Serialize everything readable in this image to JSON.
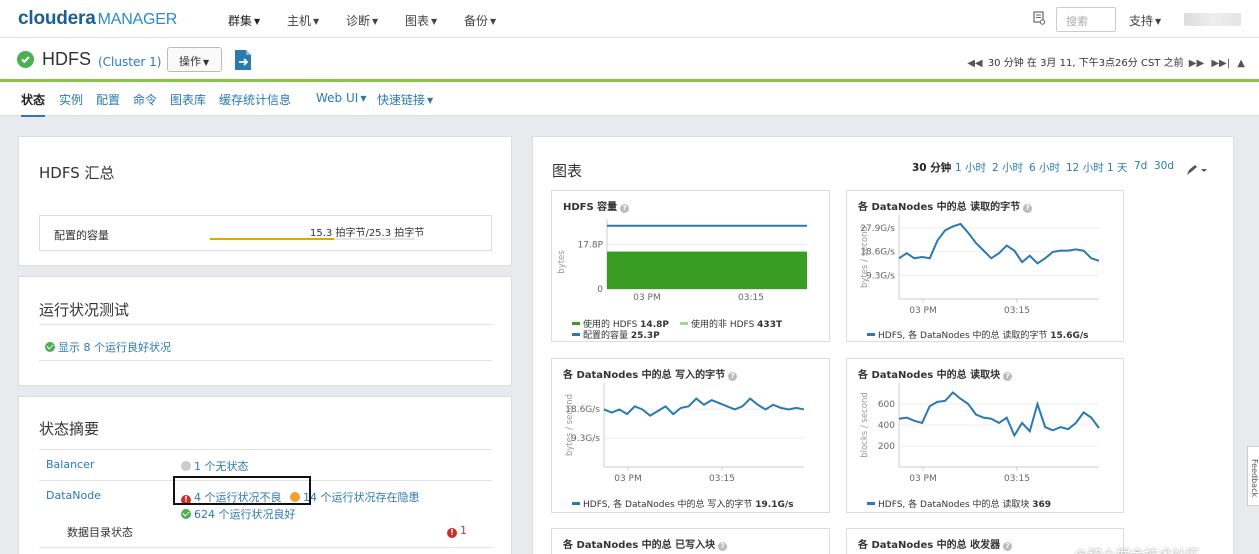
{
  "brand": {
    "name": "cloudera",
    "product": "MANAGER"
  },
  "topnav": {
    "items": [
      {
        "label": "群集",
        "active": true
      },
      {
        "label": "主机"
      },
      {
        "label": "诊断"
      },
      {
        "label": "图表"
      },
      {
        "label": "备份"
      }
    ],
    "search_placeholder": "搜索",
    "support_label": "支持"
  },
  "service": {
    "name": "HDFS",
    "cluster": "(Cluster 1)",
    "actions_label": "操作",
    "status": "good",
    "timeline": "30 分钟 在 3月 11, 下午3点26分 CST 之前"
  },
  "tabs": [
    {
      "label": "状态",
      "active": true
    },
    {
      "label": "实例"
    },
    {
      "label": "配置"
    },
    {
      "label": "命令"
    },
    {
      "label": "图表库"
    },
    {
      "label": "缓存统计信息"
    },
    {
      "label": "Web UI",
      "dropdown": true
    },
    {
      "label": "快速链接",
      "dropdown": true
    }
  ],
  "summary": {
    "title": "HDFS 汇总",
    "capacity_label": "配置的容量",
    "capacity_value": "15.3 拍字节/25.3 拍字节",
    "capacity_fraction": 0.605
  },
  "health_tests": {
    "title": "运行状况测试",
    "link": "显示 8 个运行良好状况"
  },
  "status_summary": {
    "title": "状态摘要",
    "balancer": {
      "label": "Balancer",
      "status": "1 个无状态"
    },
    "datanode": {
      "label": "DataNode",
      "bad": "4 个运行状况不良",
      "concerning": "14 个运行状况存在隐患",
      "good": "624 个运行状况良好"
    },
    "data_dir": {
      "label": "数据目录状态",
      "count": "1"
    }
  },
  "charts": {
    "title": "图表",
    "ranges": [
      "30 分钟",
      "1 小时",
      "2 小时",
      "6 小时",
      "12 小时",
      "1 天",
      "7d",
      "30d"
    ],
    "selected_range": "30 分钟",
    "x_ticks": [
      "03 PM",
      "03:15"
    ]
  },
  "chart_data": [
    {
      "type": "area",
      "title": "HDFS 容量",
      "ylabel": "bytes",
      "y_ticks": [
        "17.8P",
        "0"
      ],
      "series": [
        {
          "name": "使用的 HDFS",
          "value": "14.8P",
          "color": "#3a9d23"
        },
        {
          "name": "使用的非 HDFS",
          "value": "433T",
          "color": "#a6d49a"
        },
        {
          "name": "配置的容量",
          "value": "25.3P",
          "color": "#2a7ab0"
        }
      ]
    },
    {
      "type": "line",
      "title": "各 DataNodes 中的总 读取的字节",
      "ylabel": "bytes / second",
      "y_ticks": [
        "27.9G/s",
        "18.6G/s",
        "9.3G/s"
      ],
      "ylim": [
        0,
        33
      ],
      "values": [
        16,
        18,
        16,
        16.5,
        16,
        23,
        27,
        28.5,
        29.5,
        26,
        22,
        19,
        16,
        18,
        21,
        19,
        14.5,
        17,
        14,
        16,
        18.5,
        19,
        19,
        19.5,
        19,
        16,
        15
      ],
      "series": [
        {
          "name": "HDFS, 各 DataNodes 中的总 读取的字节",
          "value": "15.6G/s",
          "color": "#2a7ab0"
        }
      ]
    },
    {
      "type": "line",
      "title": "各 DataNodes 中的总 写入的字节",
      "ylabel": "bytes / second",
      "y_ticks": [
        "18.6G/s",
        "9.3G/s"
      ],
      "ylim": [
        0,
        27
      ],
      "values": [
        18.5,
        17.5,
        18.5,
        17,
        19.5,
        18.5,
        16.5,
        18,
        19.5,
        17,
        19,
        19.5,
        22,
        20,
        21.5,
        20.5,
        19.5,
        18.5,
        19.5,
        22,
        20,
        18.5,
        20,
        19,
        18.5,
        19,
        18.5
      ],
      "series": [
        {
          "name": "HDFS, 各 DataNodes 中的总 写入的字节",
          "value": "19.1G/s",
          "color": "#2a7ab0"
        }
      ]
    },
    {
      "type": "line",
      "title": "各 DataNodes 中的总 读取块",
      "ylabel": "blocks / second",
      "y_ticks": [
        "600",
        "400",
        "200"
      ],
      "ylim": [
        0,
        800
      ],
      "values": [
        460,
        470,
        440,
        420,
        580,
        620,
        630,
        710,
        650,
        600,
        500,
        470,
        460,
        420,
        470,
        300,
        420,
        340,
        600,
        380,
        350,
        380,
        360,
        420,
        520,
        470,
        370
      ],
      "series": [
        {
          "name": "HDFS, 各 DataNodes 中的总 读取块",
          "value": "369",
          "color": "#2a7ab0"
        }
      ]
    }
  ],
  "more_charts": [
    "各 DataNodes 中的总 已写入块",
    "各 DataNodes 中的总 收发器"
  ],
  "feedback_label": "Feedback",
  "watermark": "@稀土掘金技术社区"
}
